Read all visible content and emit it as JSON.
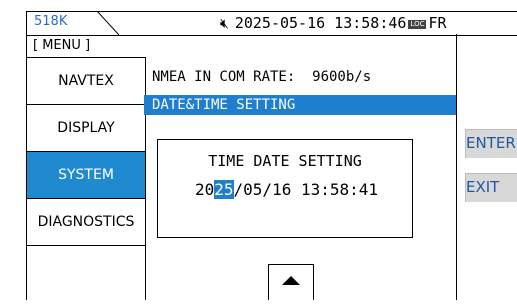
{
  "topbar": {
    "tab_label": "518K",
    "mute_icon": "speaker-mute-icon",
    "datetime": "2025-05-16 13:58:46",
    "loc_badge": "LOC",
    "mode": "FR"
  },
  "menu": {
    "label": "[ MENU ]"
  },
  "nav": {
    "items": [
      {
        "label": "NAVTEX",
        "active": false
      },
      {
        "label": "DISPLAY",
        "active": false
      },
      {
        "label": "SYSTEM",
        "active": true
      },
      {
        "label": "DIAGNOSTICS",
        "active": false
      }
    ]
  },
  "main": {
    "row1": "NMEA IN COM RATE:  9600b/s",
    "row2": "DATE&TIME SETTING",
    "dialog": {
      "title": "TIME DATE SETTING",
      "value_pre": "20",
      "value_cursor": "25",
      "value_post": "/05/16 13:58:41"
    },
    "scroll_up_icon": "up-arrow-icon"
  },
  "softkeys": {
    "enter": "ENTER",
    "exit": "EXIT"
  },
  "colors": {
    "selection": "#1f7fcf",
    "nav_active": "#1f8ad0",
    "tab_text": "#2a6bbf",
    "softkey_bg": "#d8d8d8"
  }
}
